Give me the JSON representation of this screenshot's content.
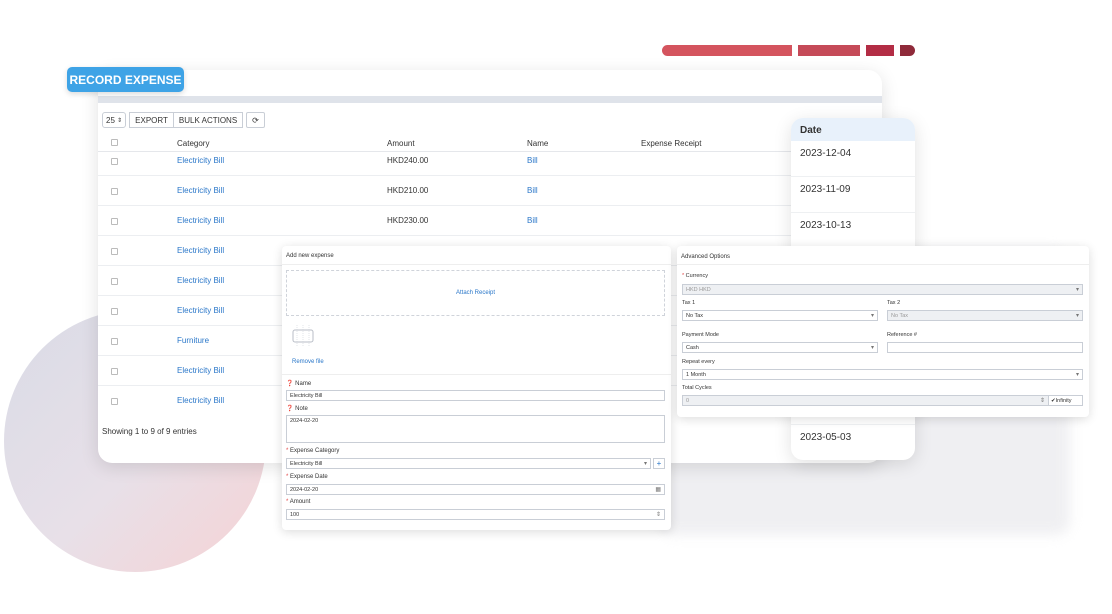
{
  "badge": "RECORD EXPENSE",
  "accent_colors": [
    "#d4545e",
    "#c54a58",
    "#b32d45",
    "#8f2a3a"
  ],
  "toolbar": {
    "page_size": "25",
    "export": "EXPORT",
    "bulk": "BULK ACTIONS",
    "refresh_icon": "refresh-icon"
  },
  "table": {
    "headers": {
      "category": "Category",
      "amount": "Amount",
      "name": "Name",
      "receipt": "Expense Receipt"
    },
    "rows": [
      {
        "category": "Electricity Bill",
        "amount": "HKD240.00",
        "name": "Bill"
      },
      {
        "category": "Electricity Bill",
        "amount": "HKD210.00",
        "name": "Bill"
      },
      {
        "category": "Electricity Bill",
        "amount": "HKD230.00",
        "name": "Bill"
      },
      {
        "category": "Electricity Bill",
        "amount": "",
        "name": ""
      },
      {
        "category": "Electricity Bill",
        "amount": "",
        "name": ""
      },
      {
        "category": "Electricity Bill",
        "amount": "",
        "name": ""
      },
      {
        "category": "Furniture",
        "amount": "",
        "name": ""
      },
      {
        "category": "Electricity Bill",
        "amount": "",
        "name": ""
      },
      {
        "category": "Electricity Bill",
        "amount": "",
        "name": ""
      }
    ],
    "footer": "Showing 1 to 9 of 9 entries"
  },
  "dates": {
    "header": "Date",
    "items": [
      "2023-12-04",
      "2023-11-09",
      "2023-10-13"
    ],
    "last": "2023-05-03"
  },
  "form": {
    "title": "Add new expense",
    "attach": "Attach Receipt",
    "remove": "Remove file",
    "name_label": "Name",
    "name_value": "Electricity Bill",
    "note_label": "Note",
    "note_value": "2024-02-20",
    "category_label": "Expense Category",
    "category_value": "Electricity Bill",
    "date_label": "Expense Date",
    "date_value": "2024-02-20",
    "amount_label": "Amount",
    "amount_value": "100"
  },
  "advanced": {
    "title": "Advanced Options",
    "currency_label": "Currency",
    "currency_value": "HKD HKD",
    "tax1_label": "Tax 1",
    "tax1_value": "No Tax",
    "tax2_label": "Tax 2",
    "tax2_value": "No Tax",
    "payment_label": "Payment Mode",
    "payment_value": "Cash",
    "reference_label": "Reference #",
    "reference_value": "",
    "repeat_label": "Repeat every",
    "repeat_value": "1 Month",
    "cycles_label": "Total Cycles",
    "cycles_value": "0",
    "infinity": "Infinity"
  }
}
